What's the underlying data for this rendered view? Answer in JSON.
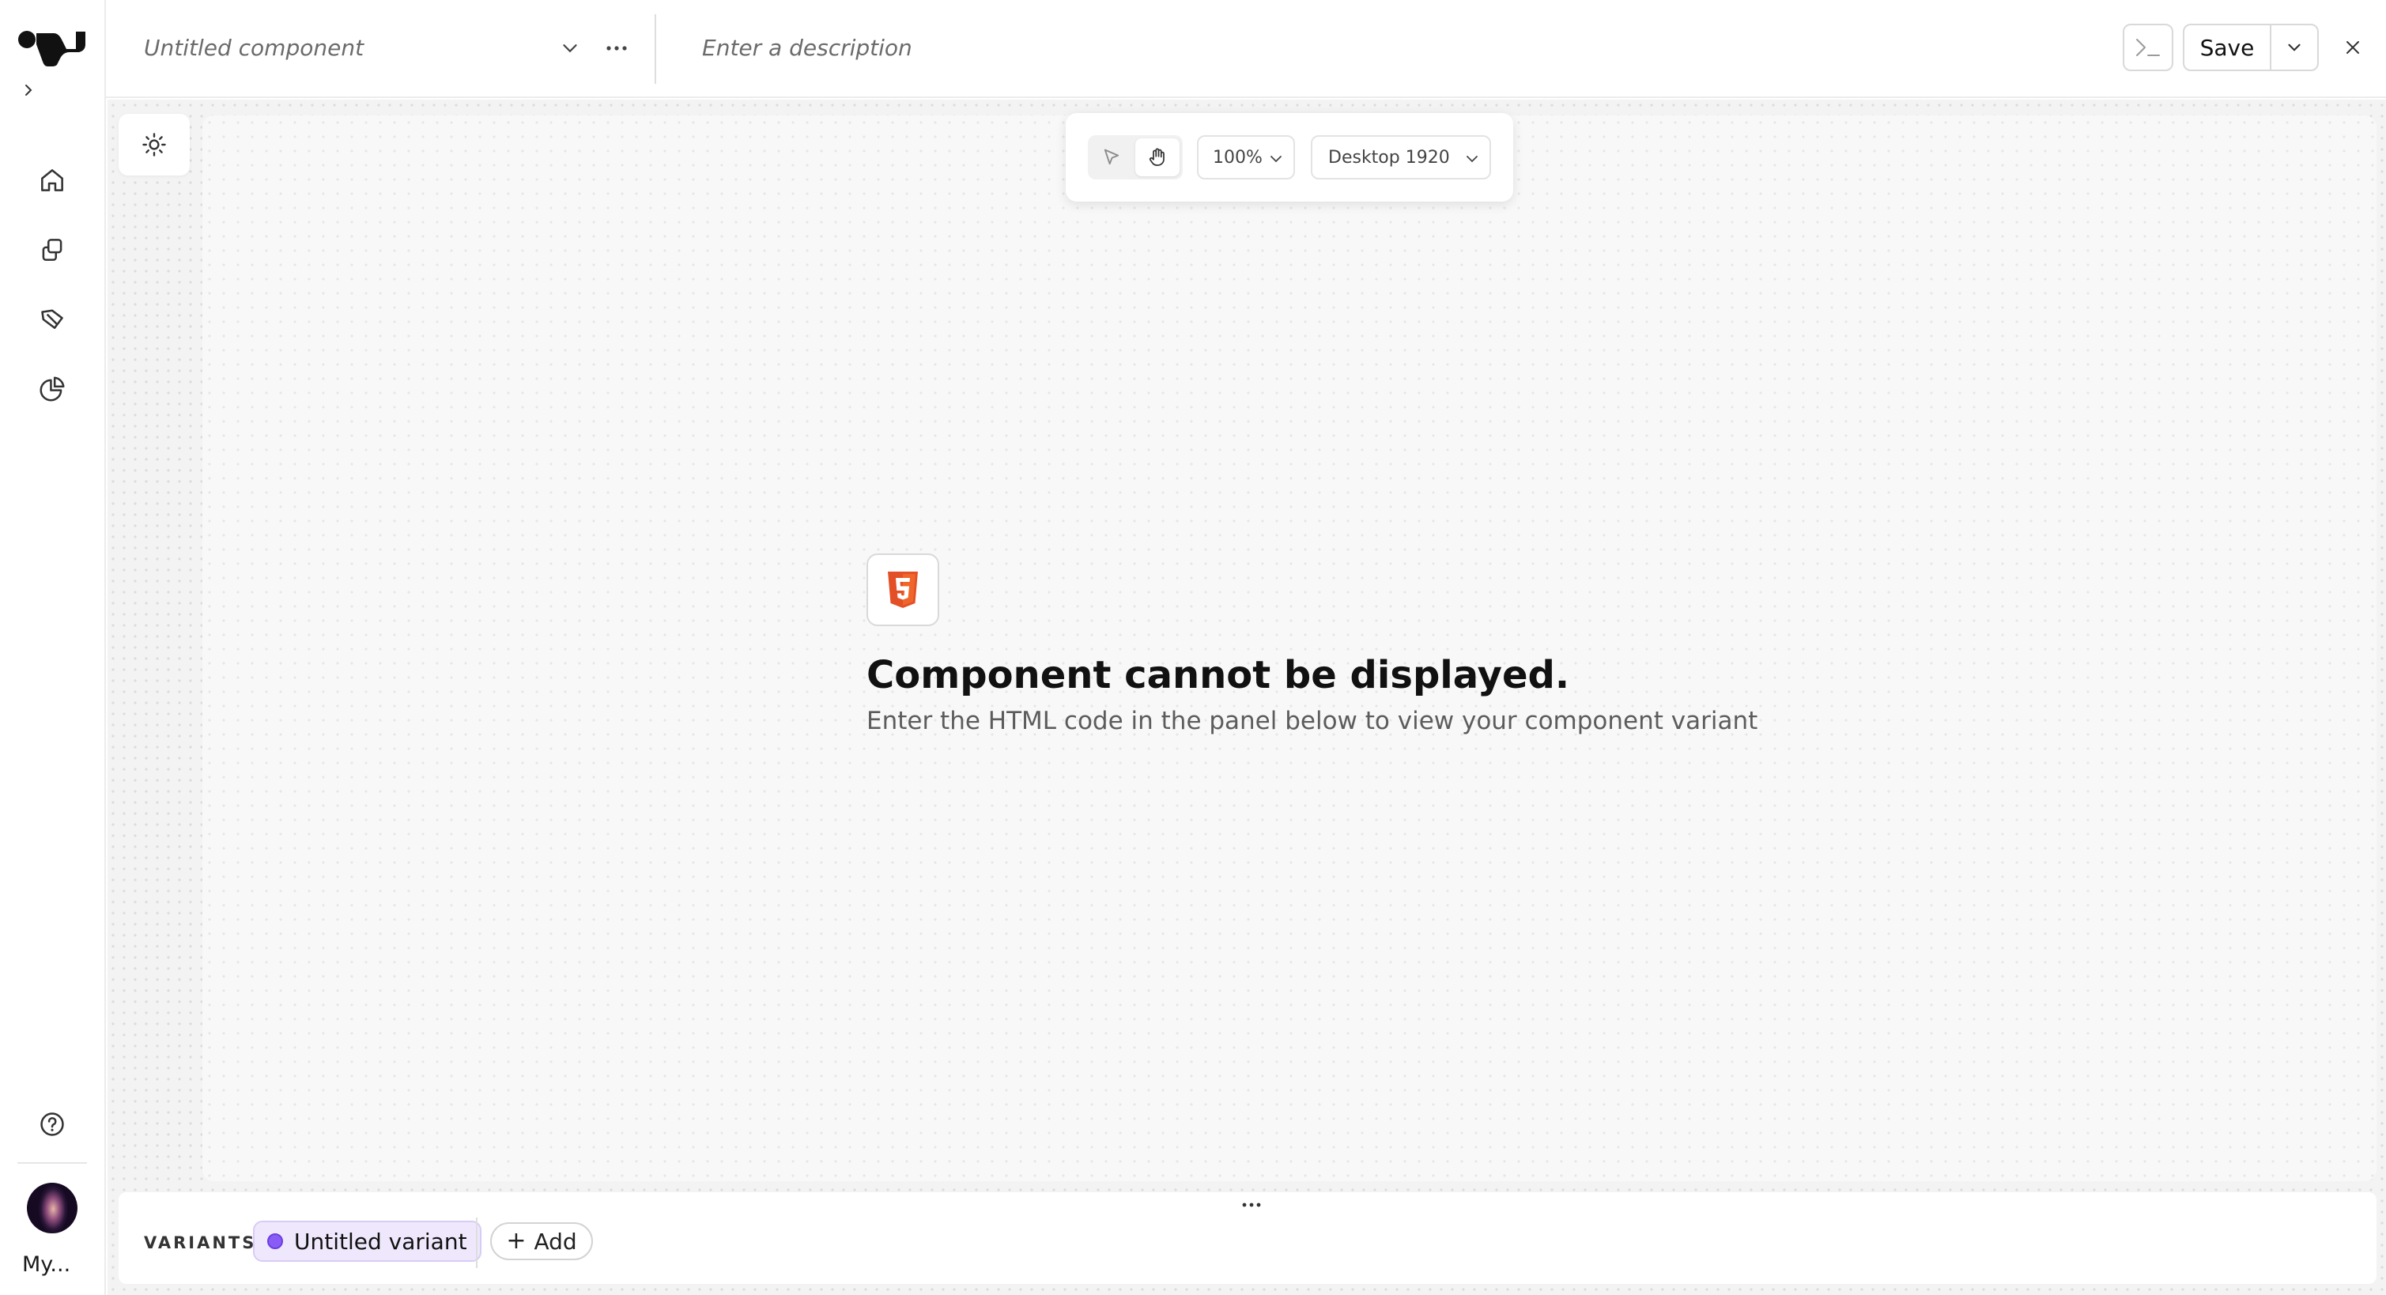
{
  "app": {
    "workspace_label": "My..."
  },
  "sidebar": {
    "items": [
      {
        "icon": "home-icon"
      },
      {
        "icon": "components-icon"
      },
      {
        "icon": "design-tag-icon"
      },
      {
        "icon": "analytics-icon"
      }
    ],
    "help_icon": "help-icon"
  },
  "header": {
    "component_name_placeholder": "Untitled component",
    "description_placeholder": "Enter a description",
    "save_label": "Save"
  },
  "canvas_toolbar": {
    "zoom": "100%",
    "device": "Desktop 1920"
  },
  "empty_state": {
    "icon": "html5-icon",
    "title": "Component cannot be displayed.",
    "subtitle": "Enter the HTML code in the panel below to view your component variant"
  },
  "variants": {
    "label": "VARIANTS",
    "items": [
      {
        "name": "Untitled variant",
        "color": "#8a5cf6"
      }
    ],
    "add_label": "Add"
  },
  "colors": {
    "accent_purple": "#8a5cf6",
    "html5_orange": "#e34f26"
  }
}
